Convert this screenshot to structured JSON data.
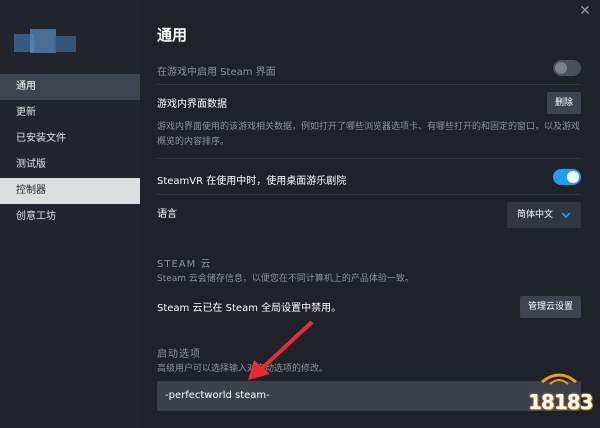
{
  "sidebar": {
    "items": [
      {
        "label": "通用",
        "state": "active"
      },
      {
        "label": "更新",
        "state": ""
      },
      {
        "label": "已安装文件",
        "state": ""
      },
      {
        "label": "测试版",
        "state": ""
      },
      {
        "label": "控制器",
        "state": "highlight"
      },
      {
        "label": "创意工坊",
        "state": ""
      }
    ]
  },
  "main": {
    "title": "通用",
    "overlay_label": "在游戏中启用 Steam 界面",
    "overlay_toggle": "off",
    "ingame_data_label": "游戏内界面数据",
    "delete_button": "删除",
    "ingame_desc": "游戏内界面使用的该游戏相关数据，例如打开了哪些浏览器选项卡、有哪些打开的和固定的窗口，以及游戏概览的内容排序。",
    "steamvr_label": "SteamVR 在使用中时，使用桌面游乐剧院",
    "steamvr_toggle": "on",
    "language_label": "语言",
    "language_value": "简体中文",
    "cloud_header": "STEAM 云",
    "cloud_desc": "Steam 云会储存信息，以便您在不同计算机上的产品体验一致。",
    "cloud_disabled": "Steam 云已在 Steam 全局设置中禁用。",
    "cloud_manage_button": "管理云设置",
    "launch_header": "启动选项",
    "launch_desc": "高级用户可以选择输入对启动选项的修改。",
    "launch_value": "-perfectworld steam-"
  },
  "watermark": {
    "text": "18183"
  },
  "colors": {
    "accent": "#1a9fff",
    "arrow": "#e52d2d"
  }
}
